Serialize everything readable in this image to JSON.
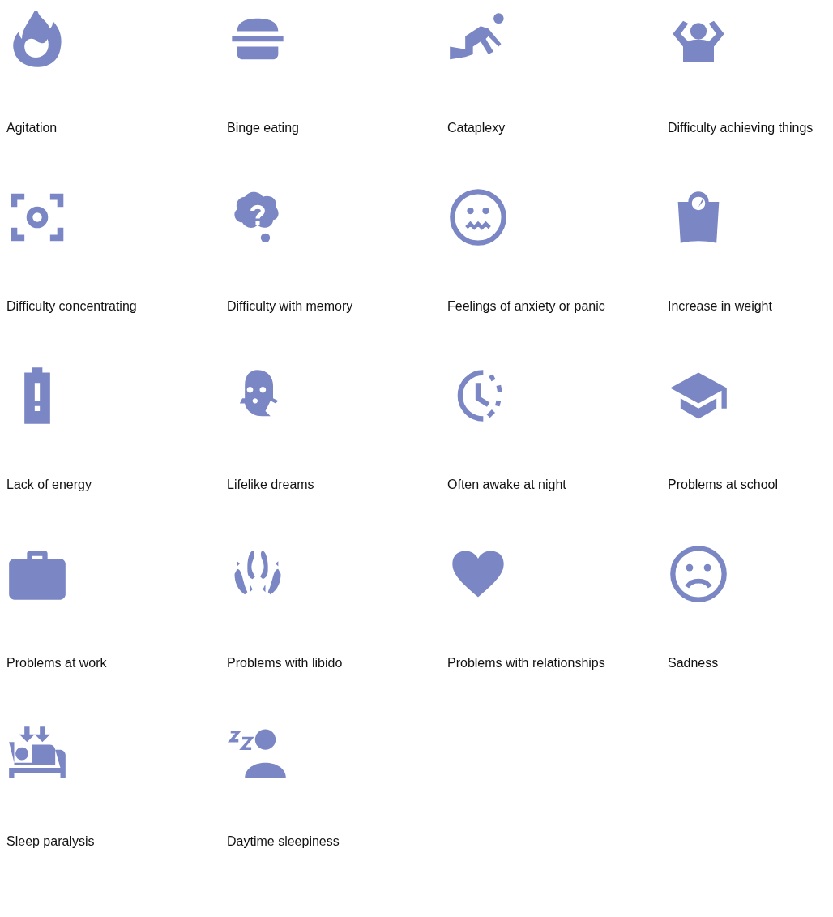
{
  "symptoms": [
    {
      "label": "Agitation"
    },
    {
      "label": "Binge eating"
    },
    {
      "label": "Cataplexy"
    },
    {
      "label": "Difficulty achieving things"
    },
    {
      "label": "Difficulty concentrating"
    },
    {
      "label": "Difficulty with memory"
    },
    {
      "label": "Feelings of anxiety or panic"
    },
    {
      "label": "Increase in weight"
    },
    {
      "label": "Lack of energy"
    },
    {
      "label": "Lifelike dreams"
    },
    {
      "label": "Often awake at night"
    },
    {
      "label": "Problems at school"
    },
    {
      "label": "Problems at work"
    },
    {
      "label": "Problems with libido"
    },
    {
      "label": "Problems with relationships"
    },
    {
      "label": "Sadness"
    },
    {
      "label": "Sleep paralysis"
    },
    {
      "label": "Daytime sleepiness"
    }
  ]
}
